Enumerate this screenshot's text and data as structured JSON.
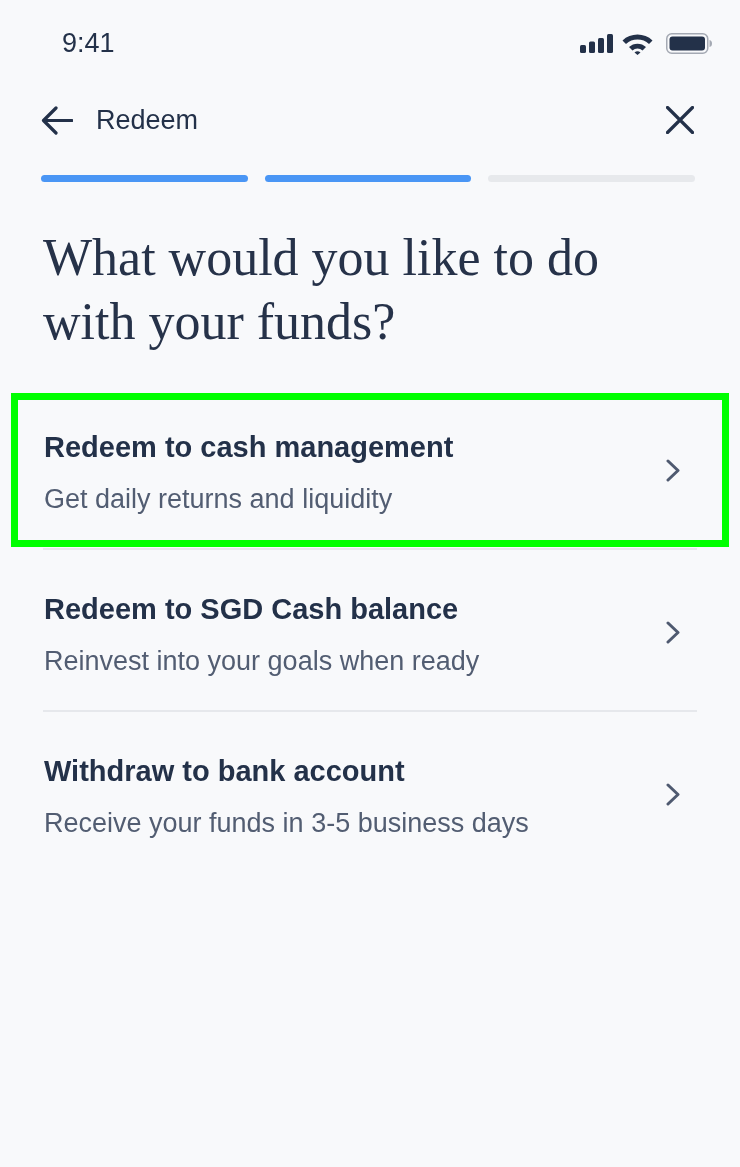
{
  "status_bar": {
    "time": "9:41"
  },
  "header": {
    "title": "Redeem"
  },
  "progress_steps": [
    {
      "completed": true
    },
    {
      "completed": true
    },
    {
      "completed": false
    }
  ],
  "question": "What would you like to do with your funds?",
  "options": [
    {
      "title": "Redeem to cash management",
      "subtitle": "Get daily returns and liquidity",
      "selected": true
    },
    {
      "title": "Redeem to SGD Cash balance",
      "subtitle": "Reinvest into your goals when ready",
      "selected": false
    },
    {
      "title": "Withdraw to bank account",
      "subtitle": "Receive your funds in 3-5 business days",
      "selected": false
    }
  ]
}
